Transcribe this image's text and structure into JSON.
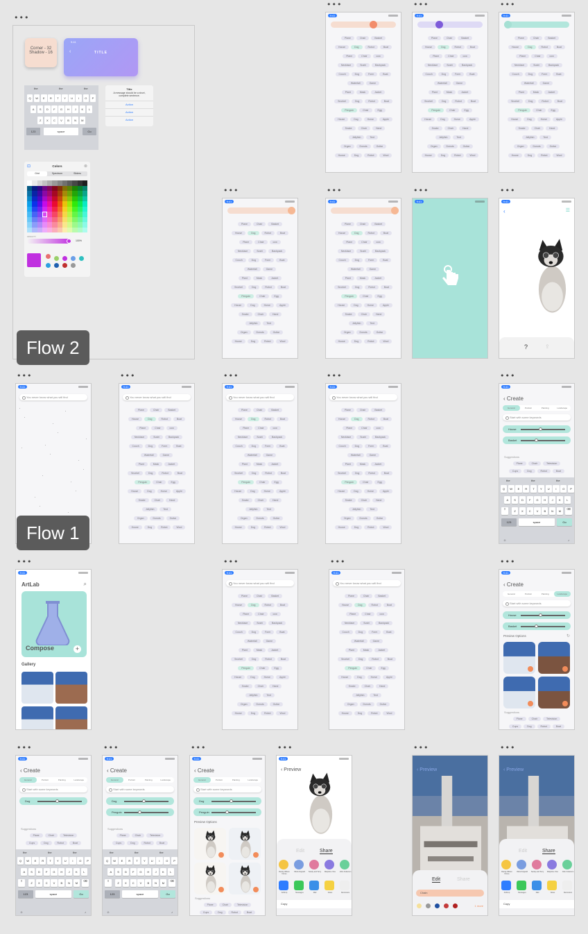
{
  "flows": {
    "flow2": "Flow 2",
    "flow1": "Flow 1"
  },
  "dots": "•••",
  "status": {
    "time": "9:41"
  },
  "shadow_card": "Corner - 32\nShadow - 16",
  "title_card": {
    "title": "TITLE",
    "time": "9:41"
  },
  "alert": {
    "title": "Title",
    "message": "A message should be a short, complete sentence.",
    "actions": [
      "Action",
      "Action",
      "Action"
    ]
  },
  "keyboard": {
    "suggestions": [
      "the",
      "the",
      "the"
    ],
    "rows": [
      [
        "Q",
        "W",
        "E",
        "R",
        "T",
        "Y",
        "U",
        "I",
        "O",
        "P"
      ],
      [
        "A",
        "S",
        "D",
        "F",
        "G",
        "H",
        "J",
        "K",
        "L"
      ],
      [
        "Z",
        "X",
        "C",
        "V",
        "B",
        "N",
        "M"
      ]
    ],
    "num": "123",
    "space": "space",
    "go": "Go"
  },
  "colors_panel": {
    "title": "Colors",
    "tabs": [
      "Grid",
      "Spectrum",
      "Sliders"
    ],
    "opacity_label": "OPACITY",
    "opacity_value": "100%"
  },
  "search_placeholder": "You never know what you will find",
  "create_search": "Start with some keywords",
  "words": [
    [
      "Plane",
      "Chair",
      "Basket"
    ],
    [
      "House",
      "Dog",
      "Robot",
      "Boat"
    ],
    [
      "Plane",
      "Chair",
      "cow"
    ],
    [
      "Necklace",
      "Sushi",
      "Backpack"
    ],
    [
      "Couch",
      "Dog",
      "Form",
      "Boat"
    ],
    [
      "Waterfall",
      "Game"
    ],
    [
      "Plant",
      "Mask",
      "Jacket"
    ],
    [
      "Snorkel",
      "Dog",
      "Robot",
      "Boat"
    ],
    [
      "Penguin",
      "Chair",
      "Egg"
    ],
    [
      "House",
      "Dog",
      "Horse",
      "Apple"
    ],
    [
      "Snake",
      "Chair",
      "Hand"
    ],
    [
      "Jellyfish",
      "Tent"
    ],
    [
      "Organ",
      "Donuts",
      "Guitar"
    ],
    [
      "House",
      "Dog",
      "Robot",
      "Wool"
    ]
  ],
  "artlab": {
    "title": "ArtLab",
    "compose": "Compose",
    "gallery": "Gallery"
  },
  "create": {
    "title": "Create",
    "tabs": [
      "General",
      "Portrait",
      "Painting",
      "Landscape"
    ],
    "sliders": [
      "House",
      "Basket"
    ],
    "sliders2": [
      "Dog",
      "Penguin"
    ],
    "suggestions": "Suggestions",
    "suggested": [
      "Plane",
      "Chair",
      "Television",
      "Cups",
      "Dog",
      "Robot",
      "Boat"
    ],
    "preview_options": "Preview Options"
  },
  "preview": {
    "title": "Preview",
    "edit": "Edit",
    "share": "Share",
    "copy": "Copy",
    "contacts": [
      "Randy Wilson Flores",
      "Olivia Koppelli",
      "Sandy and Terry",
      "Marjorine Vice",
      "John Anderson"
    ],
    "apps": [
      "AirDrop",
      "Messages",
      "Mail",
      "Notes",
      "Reminders"
    ],
    "chain_label": "Chain",
    "more": "1 more"
  }
}
